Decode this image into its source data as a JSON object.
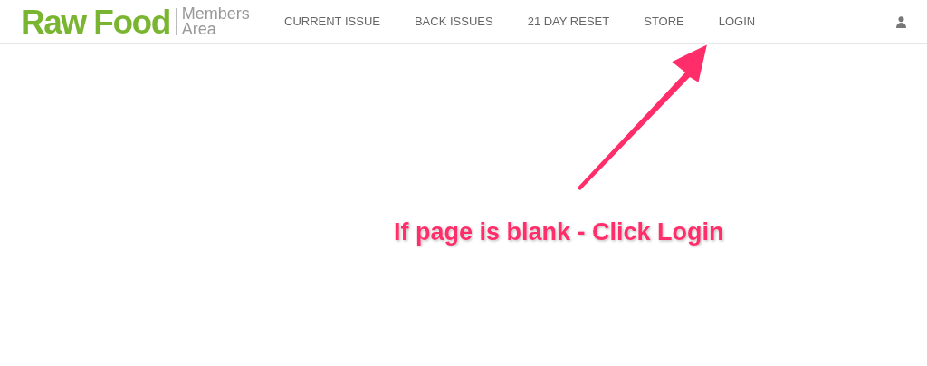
{
  "logo": {
    "brand": "Raw Food",
    "subtitle_lines": [
      "Members",
      "Area"
    ]
  },
  "nav": {
    "items": [
      {
        "label": "CURRENT ISSUE"
      },
      {
        "label": "BACK ISSUES"
      },
      {
        "label": "21 DAY RESET"
      },
      {
        "label": "STORE"
      },
      {
        "label": "LOGIN"
      }
    ]
  },
  "annotation": {
    "text": "If page is blank - Click Login"
  }
}
